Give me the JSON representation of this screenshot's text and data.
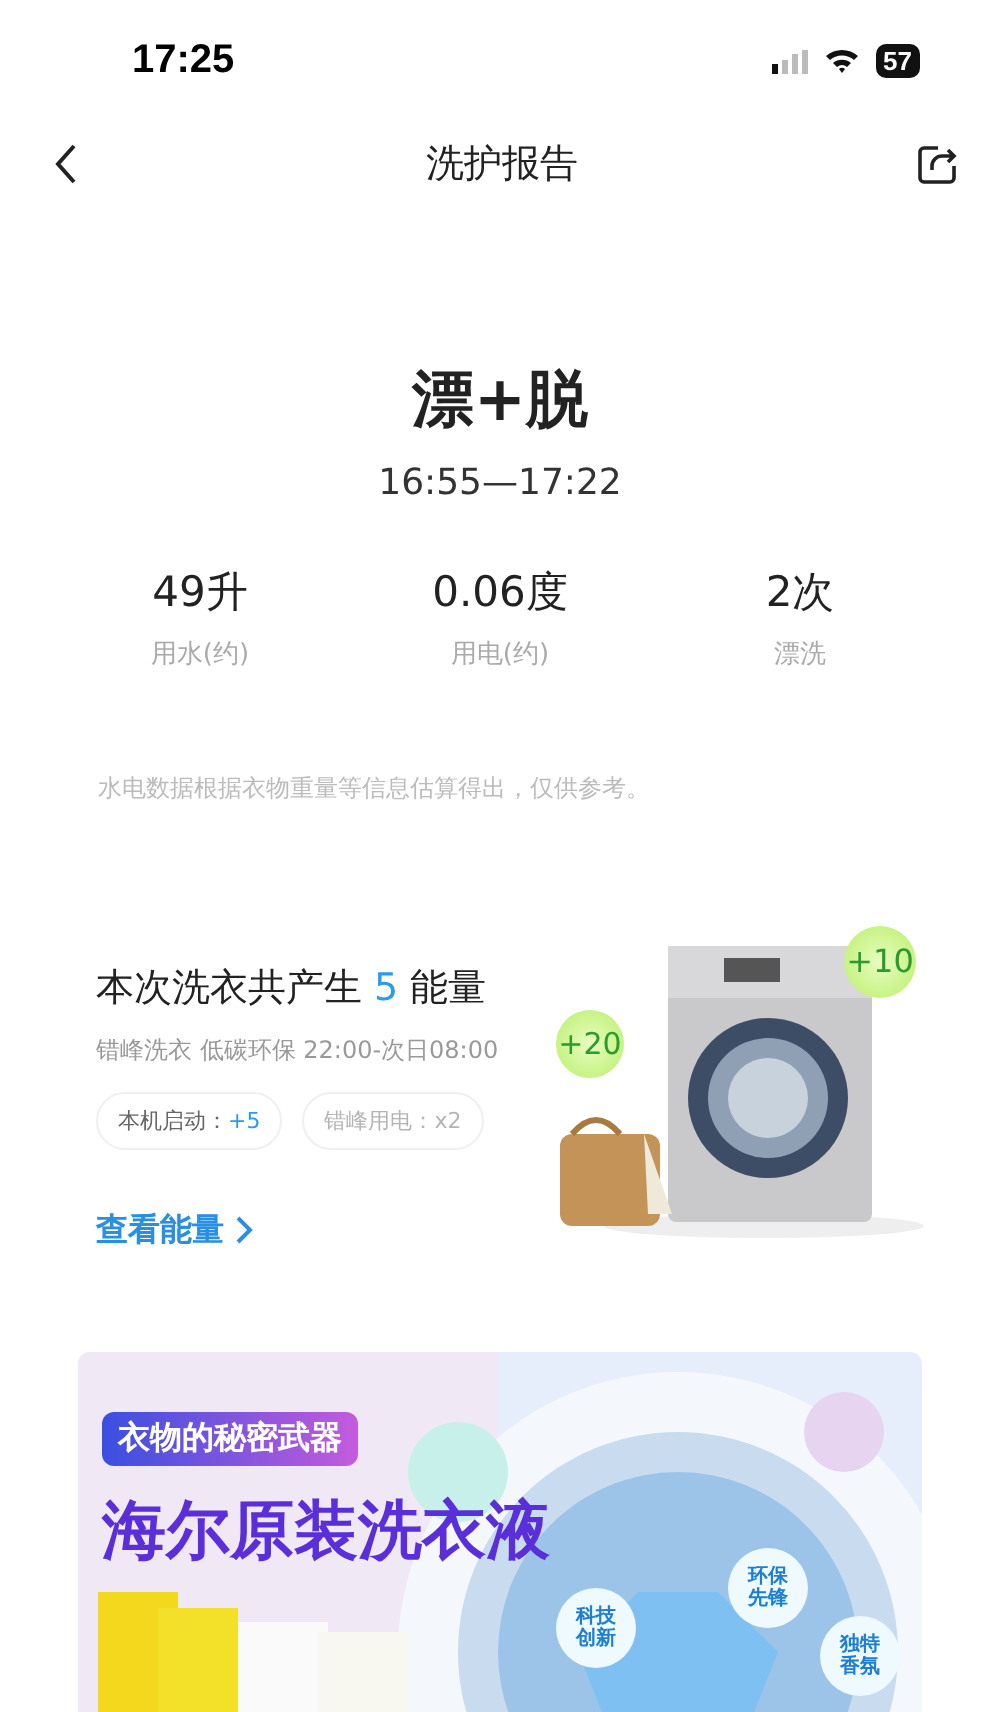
{
  "status_bar": {
    "time": "17:25",
    "battery": "57"
  },
  "nav": {
    "title": "洗护报告"
  },
  "program": {
    "name": "漂+脱",
    "time_range": "16:55—17:22"
  },
  "stats": [
    {
      "value": "49升",
      "label": "用水(约)"
    },
    {
      "value": "0.06度",
      "label": "用电(约)"
    },
    {
      "value": "2次",
      "label": "漂洗"
    }
  ],
  "note": "水电数据根据衣物重量等信息估算得出，仅供参考。",
  "energy": {
    "title_before": "本次洗衣共产生",
    "amount": "5",
    "title_after": "能量",
    "subtitle": "错峰洗衣 低碳环保 22:00-次日08:00",
    "chips": [
      {
        "label": "本机启动：",
        "bonus": "+5",
        "disabled": false
      },
      {
        "label": "错峰用电：",
        "bonus": "x2",
        "disabled": true
      }
    ],
    "link": "查看能量",
    "bubbles": [
      "+20",
      "+10"
    ]
  },
  "banner": {
    "tag": "衣物的秘密武器",
    "headline": "海尔原装洗衣液",
    "bubbles": [
      "科技创新",
      "环保先锋",
      "独特香氛"
    ]
  }
}
